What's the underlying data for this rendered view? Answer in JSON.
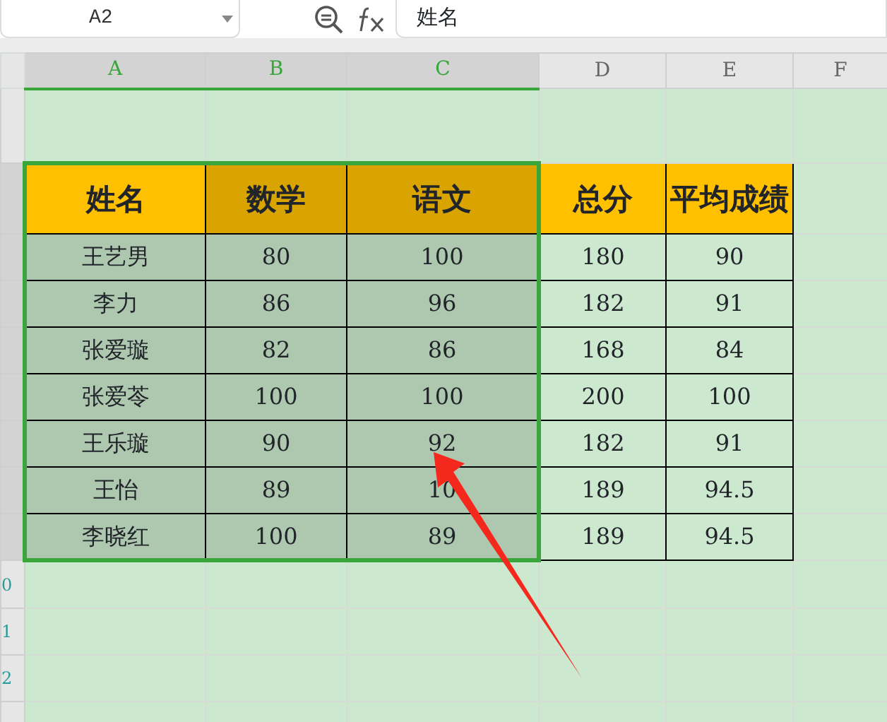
{
  "name_box": {
    "value": "A2"
  },
  "formula_bar": {
    "value": "姓名"
  },
  "columns": [
    {
      "label": "A",
      "selected": true
    },
    {
      "label": "B",
      "selected": true
    },
    {
      "label": "C",
      "selected": true
    },
    {
      "label": "D",
      "selected": false
    },
    {
      "label": "E",
      "selected": false
    },
    {
      "label": "F",
      "selected": false
    }
  ],
  "row_headers": [
    {
      "selected": false
    },
    {
      "selected": true
    },
    {
      "selected": true
    },
    {
      "selected": true
    },
    {
      "selected": true
    },
    {
      "selected": true
    },
    {
      "selected": true
    },
    {
      "selected": true
    },
    {
      "selected": true
    },
    {
      "label": "0",
      "selected": false
    },
    {
      "label": "1",
      "selected": false
    },
    {
      "label": "2",
      "selected": false
    },
    {
      "selected": false
    }
  ],
  "table": {
    "header": [
      {
        "text": "姓名",
        "active": true
      },
      {
        "text": "数学",
        "active": false
      },
      {
        "text": "语文",
        "active": false
      },
      {
        "text": "总分",
        "active": false
      },
      {
        "text": "平均成绩",
        "active": false
      }
    ],
    "rows": [
      [
        "王艺男",
        "80",
        "100",
        "180",
        "90"
      ],
      [
        "李力",
        "86",
        "96",
        "182",
        "91"
      ],
      [
        "张爱璇",
        "82",
        "86",
        "168",
        "84"
      ],
      [
        "张爱苓",
        "100",
        "100",
        "200",
        "100"
      ],
      [
        "王乐璇",
        "90",
        "92",
        "182",
        "91"
      ],
      [
        "王怡",
        "89",
        "10",
        "189",
        "94.5"
      ],
      [
        "李晓红",
        "100",
        "89",
        "189",
        "94.5"
      ]
    ]
  },
  "annotation": {
    "kind": "arrow"
  }
}
